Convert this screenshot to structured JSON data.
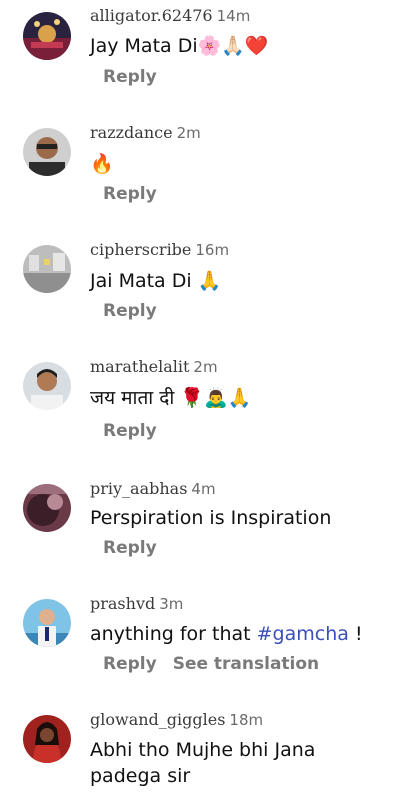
{
  "comments": [
    {
      "username": "alligator.62476",
      "time": "14m",
      "text": "Jay Mata Di🌸🙏🏻❤️",
      "reply": "Reply"
    },
    {
      "username": "razzdance",
      "time": "2m",
      "text": "🔥",
      "reply": "Reply"
    },
    {
      "username": "cipherscribe",
      "time": "16m",
      "text": "Jai Mata Di 🙏",
      "reply": "Reply"
    },
    {
      "username": "marathelalit",
      "time": "2m",
      "text": "जय माता दी 🌹🙇‍♂️🙏",
      "reply": "Reply"
    },
    {
      "username": "priy_aabhas",
      "time": "4m",
      "text": "Perspiration is Inspiration",
      "reply": "Reply"
    },
    {
      "username": "prashvd",
      "time": "3m",
      "text_prefix": "anything for that ",
      "hashtag": "#gamcha",
      "text_suffix": " !",
      "reply": "Reply",
      "translate": "See translation"
    },
    {
      "username": "glowand_giggles",
      "time": "18m",
      "text": "Abhi tho Mujhe bhi Jana padega sir"
    }
  ],
  "colors": {
    "accent_link": "#3b4fb8",
    "muted": "#7a7a7a"
  }
}
